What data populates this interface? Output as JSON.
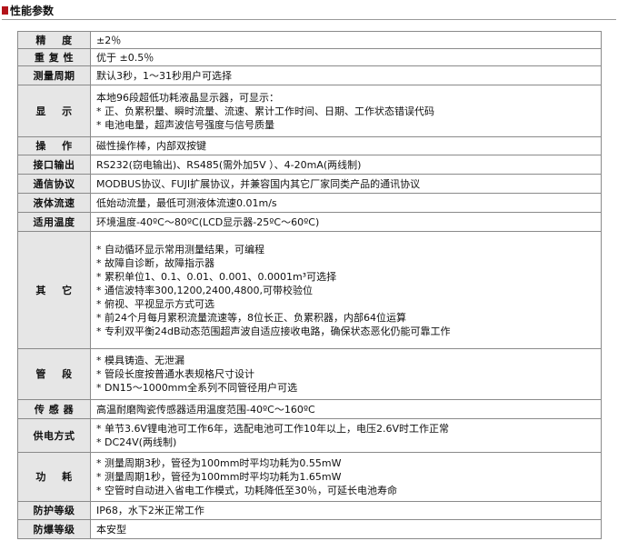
{
  "header": {
    "title": "性能参数"
  },
  "rows": [
    {
      "key": "精    度",
      "lines": [
        "±2％"
      ]
    },
    {
      "key": "重 复 性",
      "lines": [
        "优于  ±0.5％"
      ]
    },
    {
      "key": "测量周期",
      "lines": [
        "默认3秒，1～31秒用户可选择"
      ]
    },
    {
      "key": "显    示",
      "lines": [
        "本地96段超低功耗液晶显示器，可显示：",
        "* 正、负累积量、瞬时流量、流速、累计工作时间、日期、工作状态错误代码",
        "* 电池电量，超声波信号强度与信号质量"
      ]
    },
    {
      "key": "操    作",
      "lines": [
        "磁性操作棒，内部双按键"
      ]
    },
    {
      "key": "接口输出",
      "lines": [
        "RS232(窃电输出)、RS485(需外加5V ）、4-20mA(两线制)"
      ]
    },
    {
      "key": "通信协议",
      "lines": [
        "MODBUS协议、FUJI扩展协议，并兼容国内其它厂家同类产品的通讯协议"
      ]
    },
    {
      "key": "液体流速",
      "lines": [
        "低始动流量，最低可测液体流速0.01m/s"
      ]
    },
    {
      "key": "适用温度",
      "lines": [
        "环境温度-40ºC～80ºC(LCD显示器-25ºC～60ºC)"
      ]
    },
    {
      "key": "其    它",
      "lines": [
        "* 自动循环显示常用测量结果，可编程",
        "* 故障自诊断，故障指示器",
        "* 累积单位1、0.1、0.01、0.001、0.0001m³可选择",
        "* 通信波特率300,1200,2400,4800,可带校验位",
        "* 俯视、平视显示方式可选",
        "* 前24个月每月累积流量流速等，8位长正、负累积器，内部64位运算",
        "* 专利双平衡24dB动态范围超声波自适应接收电路，确保状态恶化仍能可靠工作"
      ]
    },
    {
      "key": "管    段",
      "lines": [
        "* 模具铸造、无泄漏",
        "* 管段长度按普通水表规格尺寸设计",
        "* DN15～1000mm全系列不同管径用户可选"
      ]
    },
    {
      "key": "传 感 器",
      "lines": [
        "高温耐磨陶瓷传感器适用温度范围-40ºC～160ºC"
      ]
    },
    {
      "key": "供电方式",
      "lines": [
        "* 单节3.6V锂电池可工作6年，选配电池可工作10年以上，电压2.6V时工作正常",
        "* DC24V(两线制)"
      ]
    },
    {
      "key": "功    耗",
      "lines": [
        "* 测量周期3秒，管径为100mm时平均功耗为0.55mW",
        "* 测量周期1秒，管径为100mm时平均功耗为1.65mW",
        "* 空管时自动进入省电工作模式，功耗降低至30％，可延长电池寿命"
      ]
    },
    {
      "key": "防护等级",
      "lines": [
        "IP68，水下2米正常工作"
      ]
    },
    {
      "key": "防爆等级",
      "lines": [
        "本安型"
      ]
    }
  ]
}
